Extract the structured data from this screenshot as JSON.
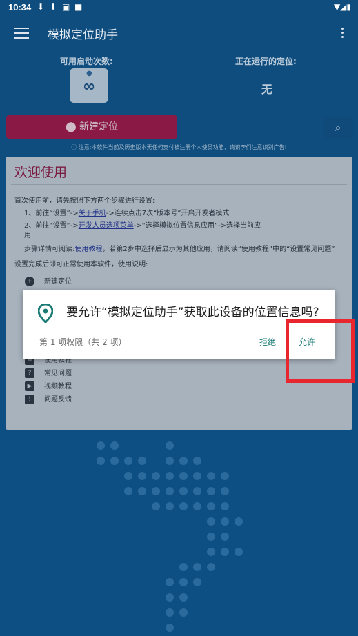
{
  "status_bar": {
    "time": "10:34"
  },
  "toolbar": {
    "title": "模拟定位助手"
  },
  "header": {
    "launch_count_label": "可用启动次数:",
    "launch_count_value": "∞",
    "running_label": "正在运行的定位:",
    "running_value": "无",
    "new_location_button": "新建定位",
    "notice": "注意:本软件当前及历史版本无任何支付被注册个人使员功能，请识李们注意识别广告!"
  },
  "card": {
    "title": "欢迎使用",
    "intro": "首次使用前，请先按照下方两个步骤进行设置:",
    "step1_prefix": "1、前往“设置”->",
    "step1_link": "关于手机",
    "step1_suffix": "->连续点击7次“版本号”开启开发者模式",
    "step2_prefix": "2、前往“设置”->",
    "step2_link": "开发人员选项菜单",
    "step2_suffix": "->“选择模拟位置信息应用”->选择当前应",
    "step2_wrap": "用",
    "detail_prefix": "步骤详情可阅读:",
    "detail_link": "使用教程",
    "detail_suffix": "，若第2步中选择后显示为其他应用，请阅读“使用教程”中的“设置常见问题”",
    "after_setup": "设置完成后即可正常使用本软件，使用说明:",
    "menu_items": [
      {
        "icon": "add-location-icon",
        "label": "新建定位"
      },
      {
        "icon": "tutorial-icon",
        "label": "使用教程"
      },
      {
        "icon": "help-icon",
        "label": "常见问题"
      },
      {
        "icon": "video-icon",
        "label": "视频教程"
      },
      {
        "icon": "feedback-icon",
        "label": "问题反馈"
      }
    ]
  },
  "dialog": {
    "question": "要允许“模拟定位助手”获取此设备的位置信息吗?",
    "permission_count": "第 1 项权限（共 2 项）",
    "deny_label": "拒绝",
    "allow_label": "允许"
  },
  "colors": {
    "accent": "#8a1a45",
    "dialog_button": "#1a7a74",
    "highlight": "#e8262d",
    "background": "#0d4f83"
  }
}
